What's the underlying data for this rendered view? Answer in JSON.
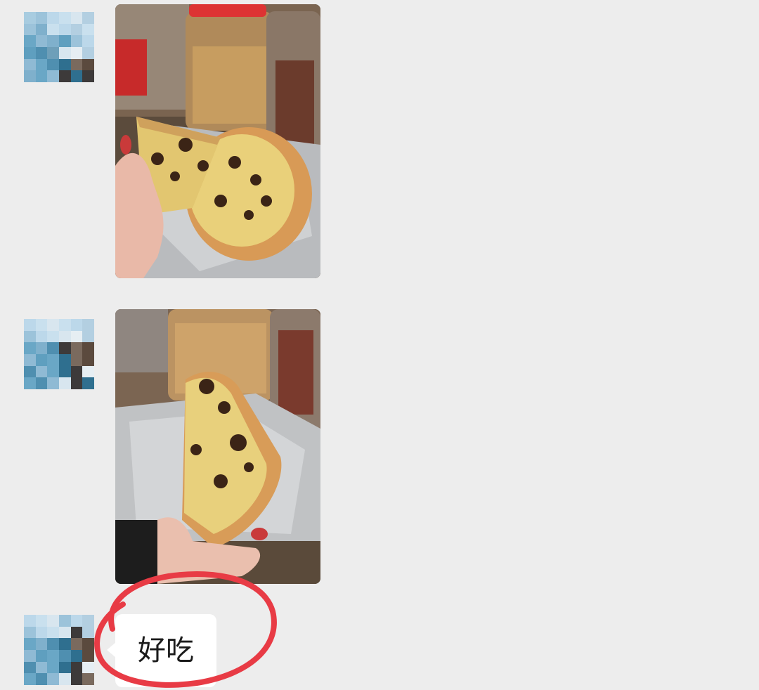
{
  "messages": [
    {
      "type": "image",
      "sender": "contact",
      "avatar_icon": "pixelated-avatar-icon",
      "image_subject": "pizza-slice-photo"
    },
    {
      "type": "image",
      "sender": "contact",
      "avatar_icon": "pixelated-avatar-icon",
      "image_subject": "pizza-slice-photo"
    },
    {
      "type": "text",
      "sender": "contact",
      "avatar_icon": "pixelated-avatar-icon",
      "text": "好吃"
    }
  ],
  "annotation": {
    "icon": "red-circle-mark-icon",
    "color": "#e83b45"
  },
  "colors": {
    "background": "#ededed",
    "bubble": "#ffffff",
    "annotation": "#e83b45"
  }
}
